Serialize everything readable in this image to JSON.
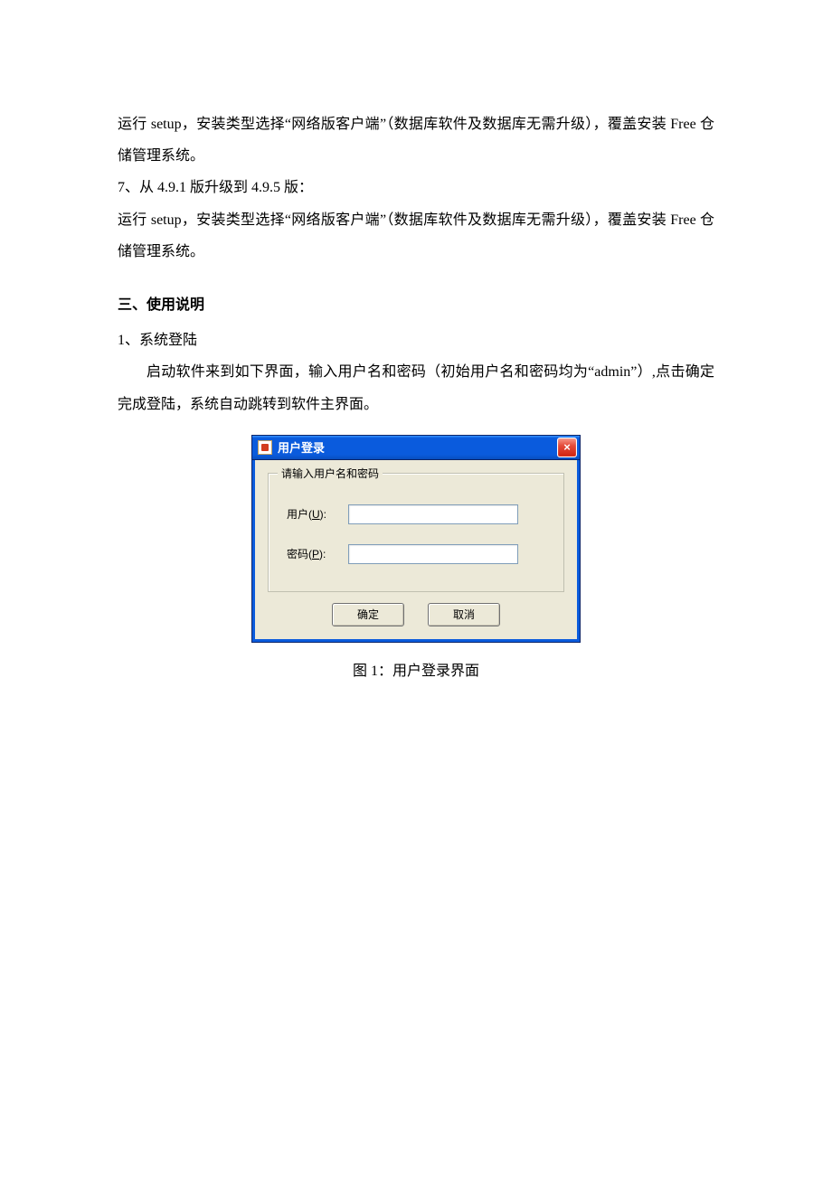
{
  "doc": {
    "p1": "运行 setup，安装类型选择“网络版客户端”（数据库软件及数据库无需升级），覆盖安装 Free 仓储管理系统。",
    "p2": "7、从 4.9.1 版升级到 4.9.5 版：",
    "p3": "运行 setup，安装类型选择“网络版客户端”（数据库软件及数据库无需升级），覆盖安装 Free 仓储管理系统。",
    "heading": "三、使用说明",
    "p4": "1、系统登陆",
    "p5": "启动软件来到如下界面，输入用户名和密码（初始用户名和密码均为“admin”）,点击确定完成登陆，系统自动跳转到软件主界面。",
    "figure_caption": "图 1：用户登录界面"
  },
  "dialog": {
    "title": "用户登录",
    "close_glyph": "×",
    "legend": "请输入用户名和密码",
    "user_label_prefix": "用户(",
    "user_label_key": "U",
    "user_label_suffix": "):",
    "pass_label_prefix": "密码(",
    "pass_label_key": "P",
    "pass_label_suffix": "):",
    "user_value": "",
    "pass_value": "",
    "ok_label": "确定",
    "cancel_label": "取消"
  }
}
